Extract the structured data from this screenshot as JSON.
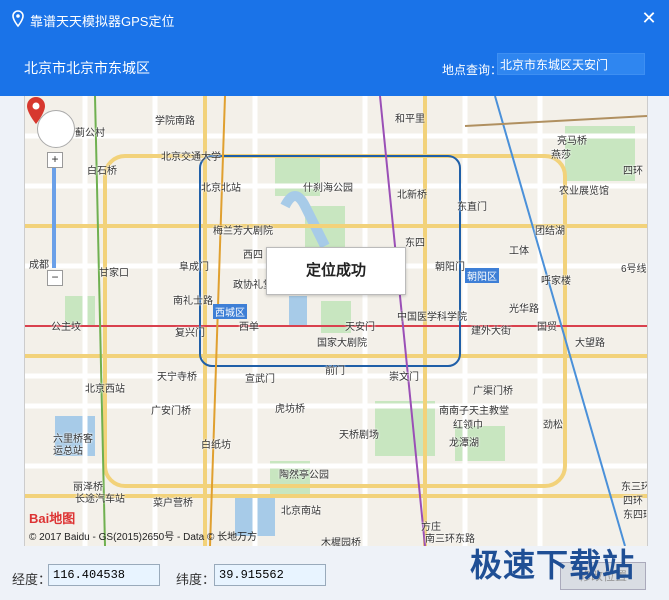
{
  "app": {
    "title": "靠谱天天模拟器GPS定位",
    "close": "✕"
  },
  "header": {
    "location": "北京市北京市东城区",
    "query_label": "地点查询：",
    "query_value": "北京市东城区天安门"
  },
  "map": {
    "popup": "定位成功",
    "logo": "Bai地图",
    "copyright": "© 2017 Baidu - GS(2015)2650号 - Data © 长地万方",
    "zoom_in": "+",
    "zoom_out": "−",
    "labels": [
      "和平里",
      "学院南路",
      "北京交通大学",
      "蓟公村",
      "白石桥",
      "北京北站",
      "什刹海公园",
      "北新桥",
      "东直门",
      "亮马桥",
      "燕莎",
      "四环",
      "农业展览馆",
      "梅兰芳大剧院",
      "东四",
      "团结湖",
      "工体",
      "龙潭湖",
      "成都",
      "甘家口",
      "阜成门",
      "西四",
      "朝阳门",
      "朝阳区",
      "呼家楼",
      "6号线",
      "南礼士路",
      "政协礼堂",
      "西城区",
      "中国医学科学院",
      "光华路",
      "公主坟",
      "复兴门",
      "西单",
      "天安门",
      "建外大街",
      "国贸",
      "大望路",
      "国家大剧院",
      "前门",
      "崇文门",
      "天宁寺桥",
      "宣武门",
      "北京西站",
      "广渠门桥",
      "广安门桥",
      "虎坊桥",
      "南南子天主教堂",
      "劲松",
      "六里桥客",
      "运总站",
      "白纸坊",
      "天桥剧场",
      "红领巾",
      "丽泽桥",
      "长途汽车站",
      "陶然亭公园",
      "菜户营桥",
      "北京南站",
      "东三环",
      "四环",
      "方庄",
      "木樨园桥",
      "南三环东路",
      "东四环"
    ]
  },
  "footer": {
    "lon_label": "经度：",
    "lon_value": "116.404538",
    "lat_label": "纬度：",
    "lat_value": "39.915562",
    "button": "修改位置"
  },
  "watermark": "极速下载站"
}
